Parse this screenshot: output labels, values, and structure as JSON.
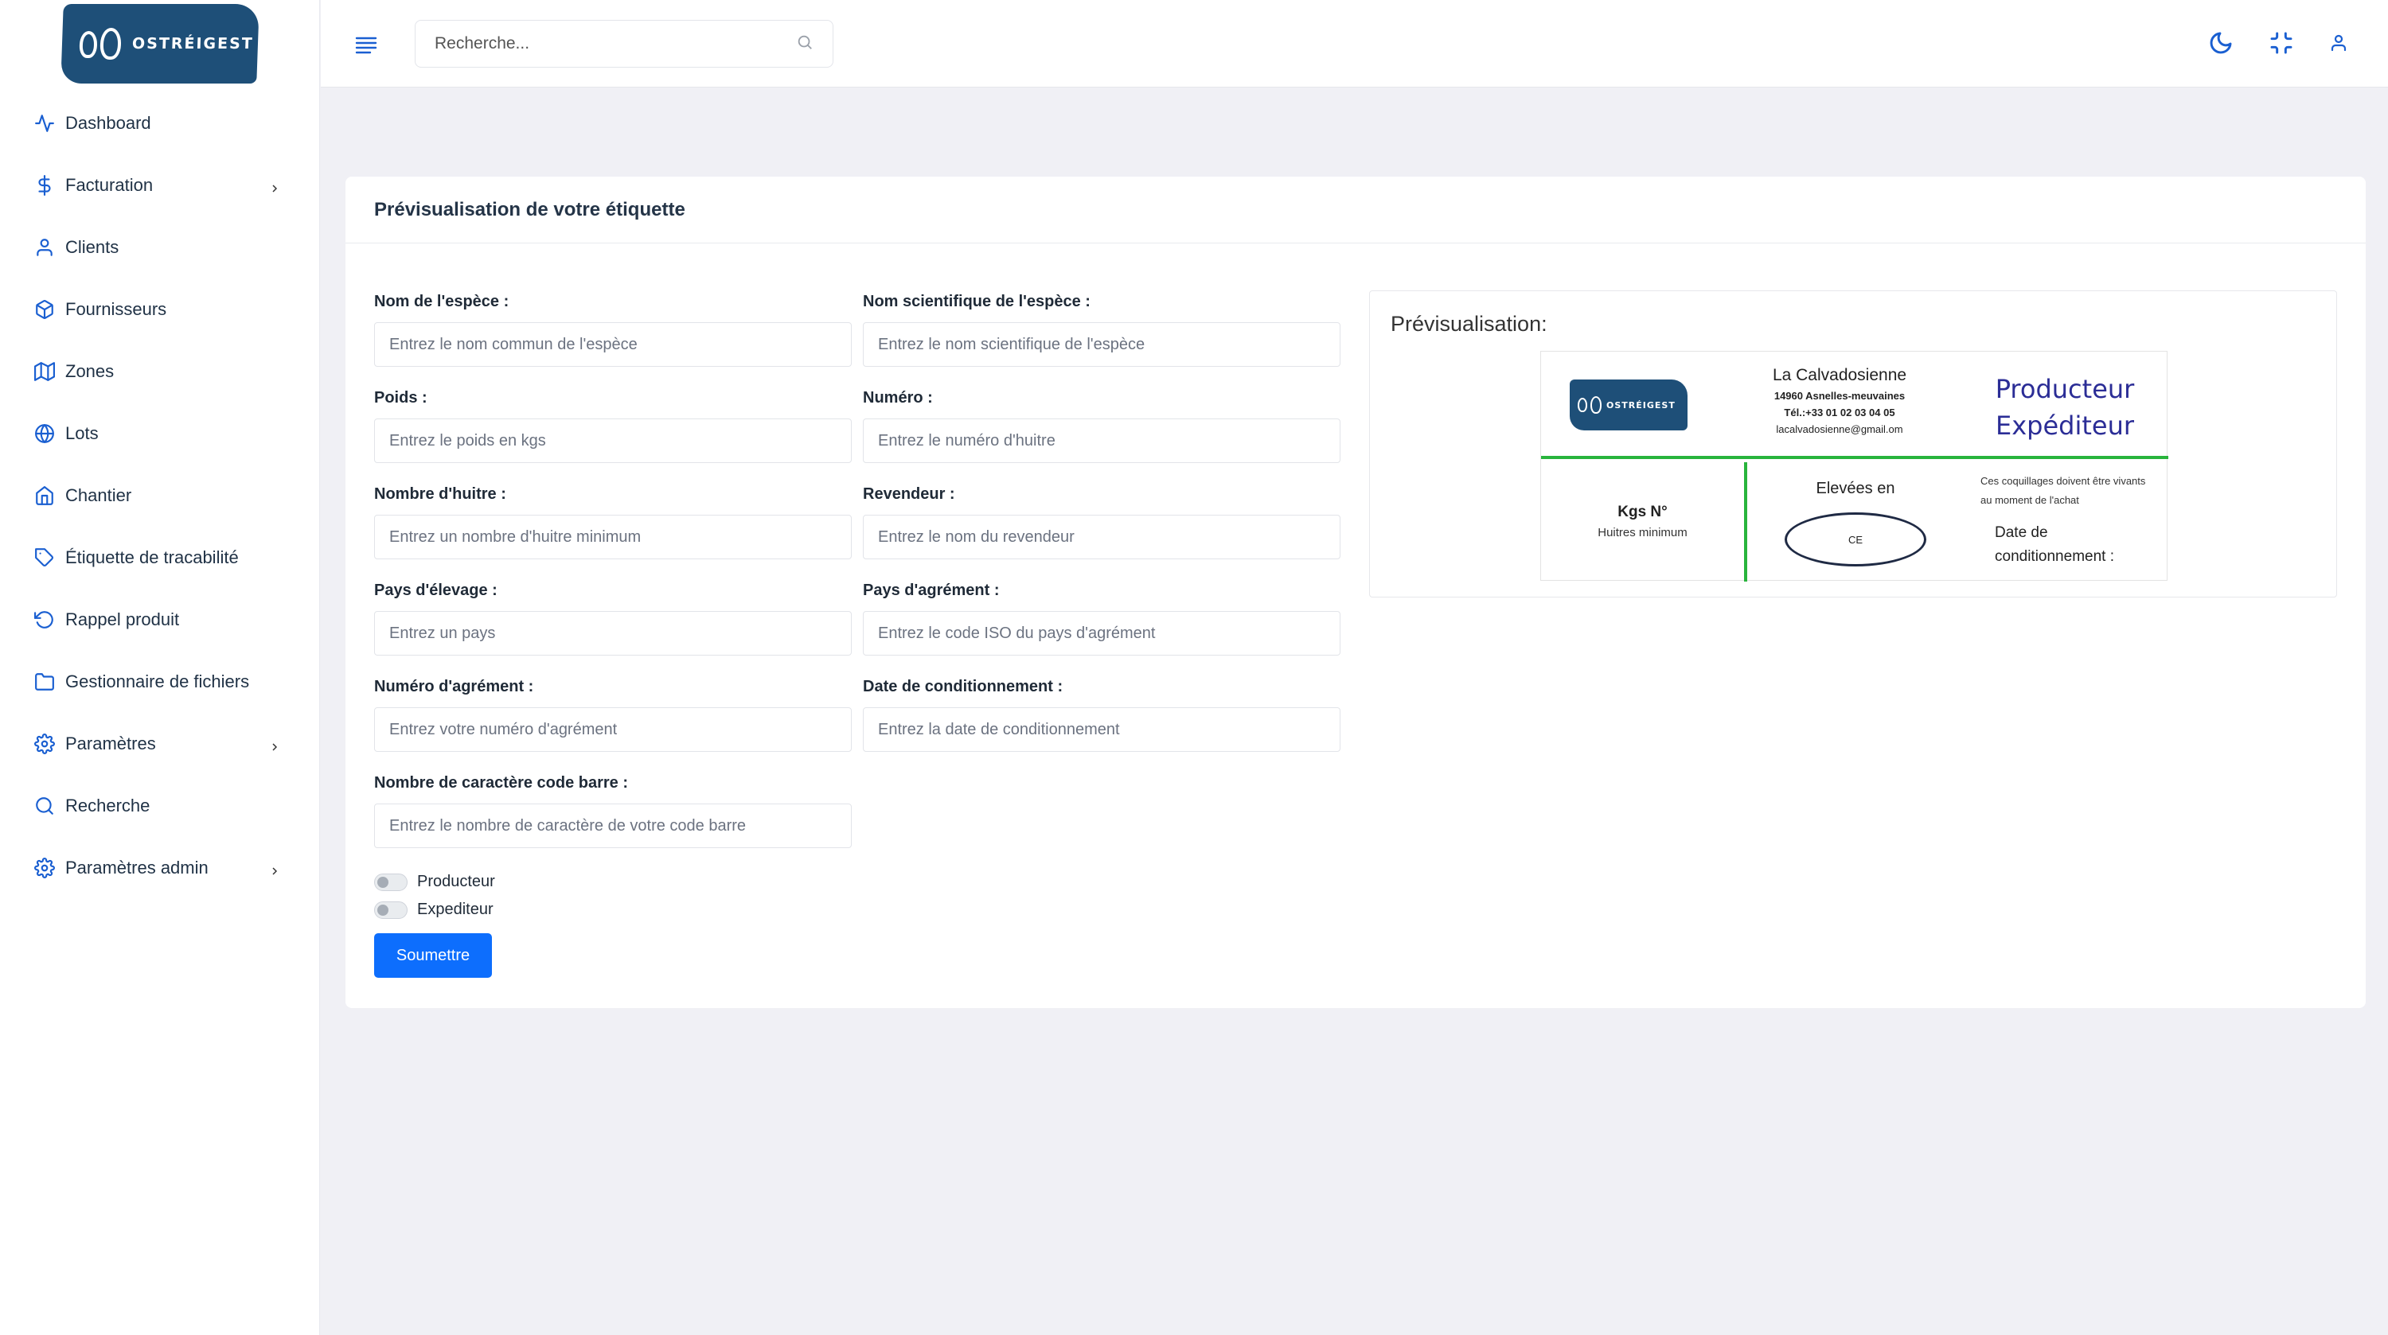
{
  "brand": {
    "name": "OSTRÉIGEST"
  },
  "sidebar": {
    "items": [
      {
        "label": "Dashboard",
        "icon": "activity-icon",
        "has_submenu": false
      },
      {
        "label": "Facturation",
        "icon": "dollar-icon",
        "has_submenu": true
      },
      {
        "label": "Clients",
        "icon": "user-icon",
        "has_submenu": false
      },
      {
        "label": "Fournisseurs",
        "icon": "box-icon",
        "has_submenu": false
      },
      {
        "label": "Zones",
        "icon": "map-icon",
        "has_submenu": false
      },
      {
        "label": "Lots",
        "icon": "globe-icon",
        "has_submenu": false
      },
      {
        "label": "Chantier",
        "icon": "home-icon",
        "has_submenu": false
      },
      {
        "label": "Étiquette de tracabilité",
        "icon": "tag-icon",
        "has_submenu": false
      },
      {
        "label": "Rappel produit",
        "icon": "rotate-ccw-icon",
        "has_submenu": false
      },
      {
        "label": "Gestionnaire de fichiers",
        "icon": "folder-icon",
        "has_submenu": false
      },
      {
        "label": "Paramètres",
        "icon": "settings-icon",
        "has_submenu": true
      },
      {
        "label": "Recherche",
        "icon": "search-icon",
        "has_submenu": false
      },
      {
        "label": "Paramètres admin",
        "icon": "settings-icon",
        "has_submenu": true
      }
    ]
  },
  "topbar": {
    "search_placeholder": "Recherche...",
    "icons": [
      "moon-icon",
      "minimize-icon",
      "user-icon"
    ]
  },
  "card": {
    "title": "Prévisualisation de votre étiquette"
  },
  "form": {
    "fields": [
      {
        "label": "Nom de l'espèce :",
        "placeholder": "Entrez le nom commun de l'espèce",
        "value": ""
      },
      {
        "label": "Nom scientifique de l'espèce :",
        "placeholder": "Entrez le nom scientifique de l'espèce",
        "value": ""
      },
      {
        "label": "Poids :",
        "placeholder": "Entrez le poids en kgs",
        "value": ""
      },
      {
        "label": "Numéro :",
        "placeholder": "Entrez le numéro d'huitre",
        "value": ""
      },
      {
        "label": "Nombre d'huitre :",
        "placeholder": "Entrez un nombre d'huitre minimum",
        "value": ""
      },
      {
        "label": "Revendeur :",
        "placeholder": "Entrez le nom du revendeur",
        "value": ""
      },
      {
        "label": "Pays d'élevage :",
        "placeholder": "Entrez un pays",
        "value": ""
      },
      {
        "label": "Pays d'agrément :",
        "placeholder": "Entrez le code ISO du pays d'agrément",
        "value": ""
      },
      {
        "label": "Numéro d'agrément :",
        "placeholder": "Entrez votre numéro d'agrément",
        "value": ""
      },
      {
        "label": "Date de conditionnement :",
        "placeholder": "Entrez la date de conditionnement",
        "value": ""
      },
      {
        "label": "Nombre de caractère code barre :",
        "placeholder": "Entrez le nombre de caractère de votre code barre",
        "value": ""
      }
    ],
    "toggles": [
      {
        "label": "Producteur",
        "checked": false
      },
      {
        "label": "Expediteur",
        "checked": false
      }
    ],
    "submit_label": "Soumettre"
  },
  "preview": {
    "title": "Prévisualisation:",
    "company_name": "La Calvadosienne",
    "address": "14960 Asnelles-meuvaines",
    "phone": "Tél.:+33 01 02 03 04 05",
    "email": "lacalvadosienne@gmail.om",
    "role_1": "Producteur",
    "role_2": "Expéditeur",
    "kgs_label": "Kgs N°",
    "huitres_label": "Huitres minimum",
    "elevees_label": "Elevées en",
    "ce_label": "CE",
    "note": "Ces coquillages doivent être vivants au moment de l'achat",
    "date_label": "Date de conditionnement :"
  },
  "colors": {
    "accent": "#1a5fd1",
    "primary_button": "#0d6efd",
    "label_divider": "#28b43c",
    "label_roles": "#2b2d96",
    "logo_bg": "#1e4f78"
  }
}
